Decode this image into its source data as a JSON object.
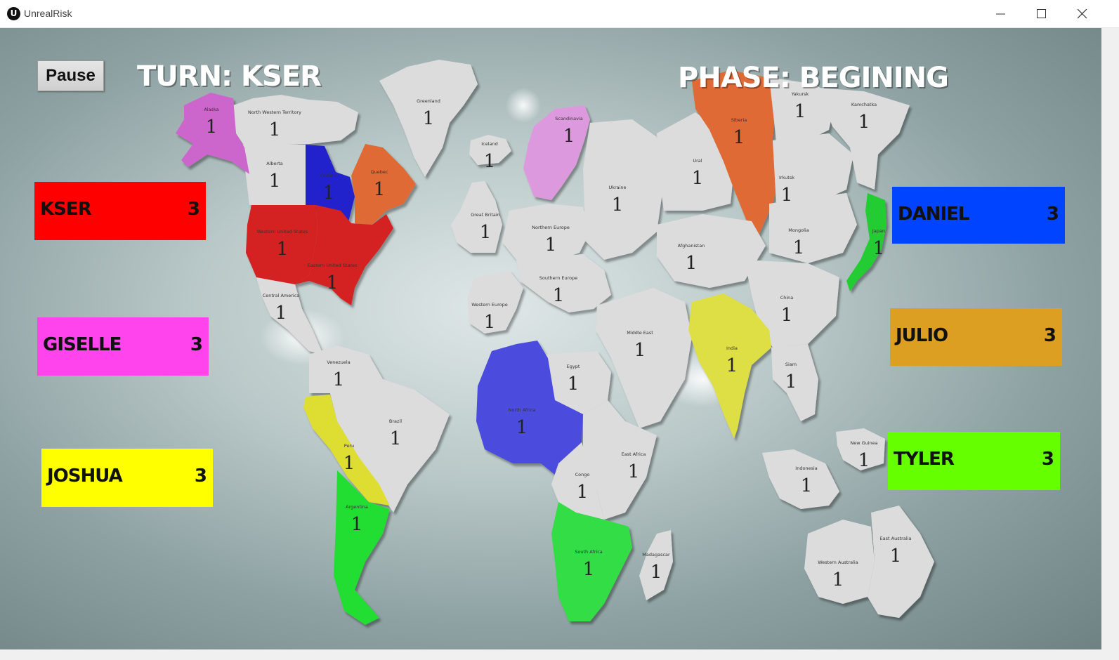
{
  "window": {
    "title": "UnrealRisk"
  },
  "hud": {
    "pause_label": "Pause",
    "turn_text": "TURN: KSER",
    "phase_text": "PHASE: BEGINING"
  },
  "players": [
    {
      "name": "KSER",
      "count": "3",
      "color": "#ff0000"
    },
    {
      "name": "GISELLE",
      "count": "3",
      "color": "#ff44ee"
    },
    {
      "name": "JOSHUA",
      "count": "3",
      "color": "#ffff00"
    },
    {
      "name": "DANIEL",
      "count": "3",
      "color": "#0044ff"
    },
    {
      "name": "JULIO",
      "count": "3",
      "color": "#dd9f22"
    },
    {
      "name": "TYLER",
      "count": "3",
      "color": "#66ff00"
    }
  ],
  "territories": [
    {
      "name": "Alaska",
      "troops": "1"
    },
    {
      "name": "North Western Territory",
      "troops": "1"
    },
    {
      "name": "Alberta",
      "troops": "1"
    },
    {
      "name": "Ontario",
      "troops": "1"
    },
    {
      "name": "Quebec",
      "troops": "1"
    },
    {
      "name": "Western United States",
      "troops": "1"
    },
    {
      "name": "Eastern United States",
      "troops": "1"
    },
    {
      "name": "Central America",
      "troops": "1"
    },
    {
      "name": "Greenland",
      "troops": "1"
    },
    {
      "name": "Iceland",
      "troops": "1"
    },
    {
      "name": "Scandinavia",
      "troops": "1"
    },
    {
      "name": "Great Britain",
      "troops": "1"
    },
    {
      "name": "Northern Europe",
      "troops": "1"
    },
    {
      "name": "Southern Europe",
      "troops": "1"
    },
    {
      "name": "Western Europe",
      "troops": "1"
    },
    {
      "name": "Ukraine",
      "troops": "1"
    },
    {
      "name": "Ural",
      "troops": "1"
    },
    {
      "name": "Siberia",
      "troops": "1"
    },
    {
      "name": "Yakursk",
      "troops": "1"
    },
    {
      "name": "Kamchatka",
      "troops": "1"
    },
    {
      "name": "Irkutsk",
      "troops": "1"
    },
    {
      "name": "Mongolia",
      "troops": "1"
    },
    {
      "name": "Japan",
      "troops": "1"
    },
    {
      "name": "Afghanistan",
      "troops": "1"
    },
    {
      "name": "China",
      "troops": "1"
    },
    {
      "name": "Middle East",
      "troops": "1"
    },
    {
      "name": "India",
      "troops": "1"
    },
    {
      "name": "Siam",
      "troops": "1"
    },
    {
      "name": "Venezuela",
      "troops": "1"
    },
    {
      "name": "Brazil",
      "troops": "1"
    },
    {
      "name": "Peru",
      "troops": "1"
    },
    {
      "name": "Argentina",
      "troops": "1"
    },
    {
      "name": "North Africa",
      "troops": "1"
    },
    {
      "name": "Egypt",
      "troops": "1"
    },
    {
      "name": "East Africa",
      "troops": "1"
    },
    {
      "name": "Congo",
      "troops": "1"
    },
    {
      "name": "South Africa",
      "troops": "1"
    },
    {
      "name": "Madagascar",
      "troops": "1"
    },
    {
      "name": "Indonesia",
      "troops": "1"
    },
    {
      "name": "New Guinea",
      "troops": "1"
    },
    {
      "name": "Western Australia",
      "troops": "1"
    },
    {
      "name": "East Australia",
      "troops": "1"
    }
  ]
}
